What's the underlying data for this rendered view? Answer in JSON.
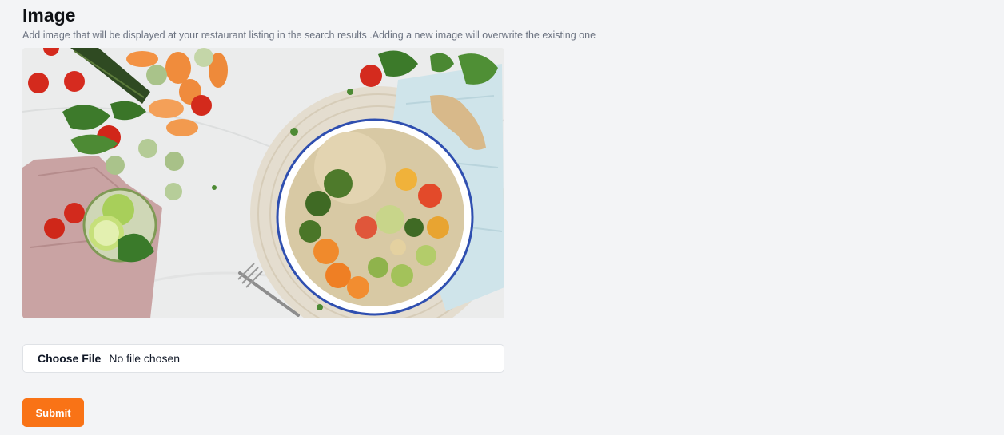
{
  "section": {
    "title": "Image",
    "description": "Add image that will be displayed at your restaurant listing in the search results .Adding a new image will overwrite the existing one"
  },
  "photo": {
    "alt": "Bowl of quinoa with roasted vegetables, tomatoes, lime and greens"
  },
  "file_input": {
    "button_label": "Choose File",
    "status": "No file chosen"
  },
  "submit": {
    "label": "Submit"
  },
  "colors": {
    "background": "#f3f4f6",
    "accent": "#f97316",
    "title": "#0f1115",
    "subtitle": "#6b7280"
  }
}
